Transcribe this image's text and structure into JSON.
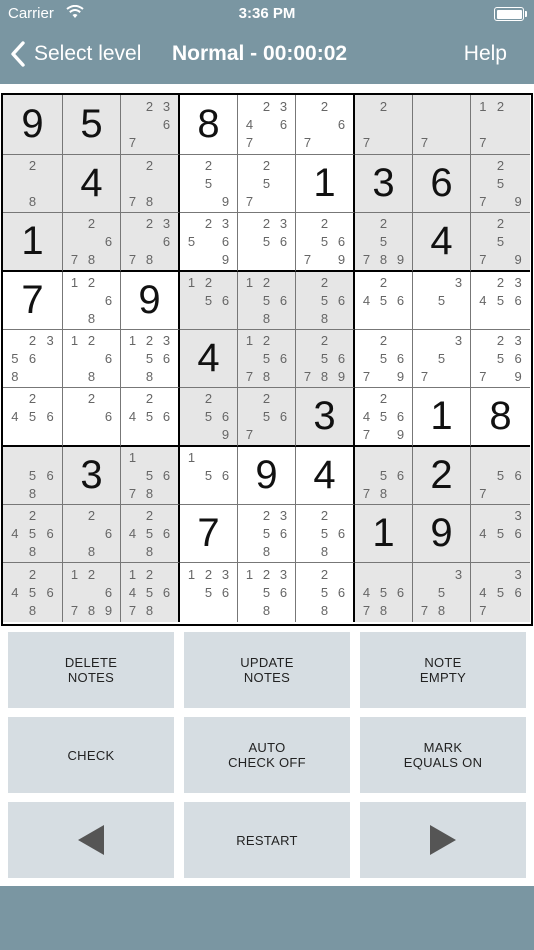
{
  "status_bar": {
    "carrier": "Carrier",
    "time": "3:36 PM"
  },
  "nav": {
    "back_label": "Select level",
    "title": "Normal - 00:00:02",
    "help_label": "Help"
  },
  "colors": {
    "bar": "#7a96a2",
    "button_bg": "#d6dde2",
    "shaded_cell": "#e6e6e6"
  },
  "grid": {
    "rows": [
      [
        {
          "v": "9",
          "s": true
        },
        {
          "v": "5",
          "s": true
        },
        {
          "n": [
            "",
            "2",
            "3",
            "",
            "",
            "6",
            "7",
            "",
            ""
          ],
          "s": true
        },
        {
          "v": "8",
          "s": false
        },
        {
          "n": [
            "",
            "2",
            "3",
            "4",
            "",
            "6",
            "7",
            "",
            ""
          ],
          "s": false
        },
        {
          "n": [
            "",
            "2",
            "",
            "",
            "",
            "6",
            "7",
            "",
            ""
          ],
          "s": false
        },
        {
          "n": [
            "",
            "2",
            "",
            "",
            "",
            "",
            "7",
            "",
            ""
          ],
          "s": true
        },
        {
          "n": [
            "",
            "",
            "",
            "",
            "",
            "",
            "7",
            "",
            ""
          ],
          "s": true
        },
        {
          "n": [
            "1",
            "2",
            "",
            "",
            "",
            "",
            "7",
            "",
            ""
          ],
          "s": true
        }
      ],
      [
        {
          "n": [
            "",
            "2",
            "",
            "",
            "",
            "",
            "",
            "8",
            ""
          ],
          "s": true
        },
        {
          "v": "4",
          "s": true
        },
        {
          "n": [
            "",
            "2",
            "",
            "",
            "",
            "",
            "7",
            "8",
            ""
          ],
          "s": true
        },
        {
          "n": [
            "",
            "2",
            "",
            "",
            "5",
            "",
            "",
            "",
            "9"
          ],
          "s": false
        },
        {
          "n": [
            "",
            "2",
            "",
            "",
            "5",
            "",
            "7",
            "",
            ""
          ],
          "s": false
        },
        {
          "v": "1",
          "s": false
        },
        {
          "v": "3",
          "s": true
        },
        {
          "v": "6",
          "s": true
        },
        {
          "n": [
            "",
            "2",
            "",
            "",
            "5",
            "",
            "7",
            "",
            "9"
          ],
          "s": true
        }
      ],
      [
        {
          "v": "1",
          "s": true
        },
        {
          "n": [
            "",
            "2",
            "",
            "",
            "",
            "6",
            "7",
            "8",
            ""
          ],
          "s": true
        },
        {
          "n": [
            "",
            "2",
            "3",
            "",
            "",
            "6",
            "7",
            "8",
            ""
          ],
          "s": true
        },
        {
          "n": [
            "",
            "2",
            "3",
            "5",
            "",
            "6",
            "",
            "",
            "9"
          ],
          "s": false
        },
        {
          "n": [
            "",
            "2",
            "3",
            "",
            "5",
            "6",
            "",
            "",
            ""
          ],
          "s": false
        },
        {
          "n": [
            "",
            "2",
            "",
            "",
            "5",
            "6",
            "7",
            "",
            "9"
          ],
          "s": false
        },
        {
          "n": [
            "",
            "2",
            "",
            "",
            "5",
            "",
            "7",
            "8",
            "9"
          ],
          "s": true
        },
        {
          "v": "4",
          "s": true
        },
        {
          "n": [
            "",
            "2",
            "",
            "",
            "5",
            "",
            "7",
            "",
            "9"
          ],
          "s": true
        }
      ],
      [
        {
          "v": "7",
          "s": false
        },
        {
          "n": [
            "1",
            "2",
            "",
            "",
            "",
            "6",
            "",
            "8",
            ""
          ],
          "s": false
        },
        {
          "v": "9",
          "s": false
        },
        {
          "n": [
            "1",
            "2",
            "",
            "",
            "5",
            "6",
            "",
            "",
            ""
          ],
          "s": true
        },
        {
          "n": [
            "1",
            "2",
            "",
            "",
            "5",
            "6",
            "",
            "8",
            ""
          ],
          "s": true
        },
        {
          "n": [
            "",
            "2",
            "",
            "",
            "5",
            "6",
            "",
            "8",
            ""
          ],
          "s": true
        },
        {
          "n": [
            "",
            "2",
            "",
            "4",
            "5",
            "6",
            "",
            "",
            ""
          ],
          "s": false
        },
        {
          "n": [
            "",
            "",
            "3",
            "",
            "5",
            "",
            "",
            "",
            ""
          ],
          "s": false
        },
        {
          "n": [
            "",
            "2",
            "3",
            "4",
            "5",
            "6",
            "",
            "",
            ""
          ],
          "s": false
        }
      ],
      [
        {
          "n": [
            "",
            "2",
            "3",
            "5",
            "6",
            "",
            "8",
            "",
            ""
          ],
          "s": false
        },
        {
          "n": [
            "1",
            "2",
            "",
            "",
            "",
            "6",
            "",
            "8",
            ""
          ],
          "s": false
        },
        {
          "n": [
            "1",
            "2",
            "3",
            "",
            "5",
            "6",
            "",
            "8",
            ""
          ],
          "s": false
        },
        {
          "v": "4",
          "s": true
        },
        {
          "n": [
            "1",
            "2",
            "",
            "",
            "5",
            "6",
            "7",
            "8",
            ""
          ],
          "s": true
        },
        {
          "n": [
            "",
            "2",
            "",
            "",
            "5",
            "6",
            "7",
            "8",
            "9"
          ],
          "s": true
        },
        {
          "n": [
            "",
            "2",
            "",
            "",
            "5",
            "6",
            "7",
            "",
            "9"
          ],
          "s": false
        },
        {
          "n": [
            "",
            "",
            "3",
            "",
            "5",
            "",
            "7",
            "",
            ""
          ],
          "s": false
        },
        {
          "n": [
            "",
            "2",
            "3",
            "",
            "5",
            "6",
            "7",
            "",
            "9"
          ],
          "s": false
        }
      ],
      [
        {
          "n": [
            "",
            "2",
            "",
            "4",
            "5",
            "6",
            "",
            "",
            ""
          ],
          "s": false
        },
        {
          "n": [
            "",
            "2",
            "",
            "",
            "",
            "6",
            "",
            "",
            ""
          ],
          "s": false
        },
        {
          "n": [
            "",
            "2",
            "",
            "4",
            "5",
            "6",
            "",
            "",
            ""
          ],
          "s": false
        },
        {
          "n": [
            "",
            "2",
            "",
            "",
            "5",
            "6",
            "",
            "",
            "9"
          ],
          "s": true
        },
        {
          "n": [
            "",
            "2",
            "",
            "",
            "5",
            "6",
            "7",
            "",
            ""
          ],
          "s": true
        },
        {
          "v": "3",
          "s": true
        },
        {
          "n": [
            "",
            "2",
            "",
            "4",
            "5",
            "6",
            "7",
            "",
            "9"
          ],
          "s": false
        },
        {
          "v": "1",
          "s": false
        },
        {
          "v": "8",
          "s": false
        }
      ],
      [
        {
          "n": [
            "",
            "",
            "",
            "",
            "5",
            "6",
            "",
            "8",
            ""
          ],
          "s": true
        },
        {
          "v": "3",
          "s": true
        },
        {
          "n": [
            "1",
            "",
            "",
            "",
            "5",
            "6",
            "7",
            "8",
            ""
          ],
          "s": true
        },
        {
          "n": [
            "1",
            "",
            "",
            "",
            "5",
            "6",
            "",
            "",
            ""
          ],
          "s": false
        },
        {
          "v": "9",
          "s": false
        },
        {
          "v": "4",
          "s": false
        },
        {
          "n": [
            "",
            "",
            "",
            "",
            "5",
            "6",
            "7",
            "8",
            ""
          ],
          "s": true
        },
        {
          "v": "2",
          "s": true
        },
        {
          "n": [
            "",
            "",
            "",
            "",
            "5",
            "6",
            "7",
            "",
            ""
          ],
          "s": true
        }
      ],
      [
        {
          "n": [
            "",
            "2",
            "",
            "4",
            "5",
            "6",
            "",
            "8",
            ""
          ],
          "s": true
        },
        {
          "n": [
            "",
            "2",
            "",
            "",
            "",
            "6",
            "",
            "8",
            ""
          ],
          "s": true
        },
        {
          "n": [
            "",
            "2",
            "",
            "4",
            "5",
            "6",
            "",
            "8",
            ""
          ],
          "s": true
        },
        {
          "v": "7",
          "s": false
        },
        {
          "n": [
            "",
            "2",
            "3",
            "",
            "5",
            "6",
            "",
            "8",
            ""
          ],
          "s": false
        },
        {
          "n": [
            "",
            "2",
            "",
            "",
            "5",
            "6",
            "",
            "8",
            ""
          ],
          "s": false
        },
        {
          "v": "1",
          "s": true
        },
        {
          "v": "9",
          "s": true
        },
        {
          "n": [
            "",
            "",
            "3",
            "4",
            "5",
            "6",
            "",
            "",
            ""
          ],
          "s": true
        }
      ],
      [
        {
          "n": [
            "",
            "2",
            "",
            "4",
            "5",
            "6",
            "",
            "8",
            ""
          ],
          "s": true
        },
        {
          "n": [
            "1",
            "2",
            "",
            "",
            "",
            "6",
            "7",
            "8",
            "9"
          ],
          "s": true
        },
        {
          "n": [
            "1",
            "2",
            "",
            "4",
            "5",
            "6",
            "7",
            "8",
            ""
          ],
          "s": true
        },
        {
          "n": [
            "1",
            "2",
            "3",
            "",
            "5",
            "6",
            "",
            "",
            ""
          ],
          "s": false
        },
        {
          "n": [
            "1",
            "2",
            "3",
            "",
            "5",
            "6",
            "",
            "8",
            ""
          ],
          "s": false
        },
        {
          "n": [
            "",
            "2",
            "",
            "",
            "5",
            "6",
            "",
            "8",
            ""
          ],
          "s": false
        },
        {
          "n": [
            "",
            "",
            "",
            "4",
            "5",
            "6",
            "7",
            "8",
            ""
          ],
          "s": true
        },
        {
          "n": [
            "",
            "",
            "3",
            "",
            "5",
            "",
            "7",
            "8",
            ""
          ],
          "s": true
        },
        {
          "n": [
            "",
            "",
            "3",
            "4",
            "5",
            "6",
            "7",
            "",
            ""
          ],
          "s": true
        }
      ]
    ]
  },
  "controls": {
    "delete_notes": "DELETE\nNOTES",
    "update_notes": "UPDATE\nNOTES",
    "note_empty": "NOTE\nEMPTY",
    "check": "CHECK",
    "auto_check": "AUTO\nCHECK OFF",
    "mark_equals": "MARK\nEQUALS ON",
    "restart": "RESTART",
    "prev_icon": "triangle-left-icon",
    "next_icon": "triangle-right-icon"
  }
}
